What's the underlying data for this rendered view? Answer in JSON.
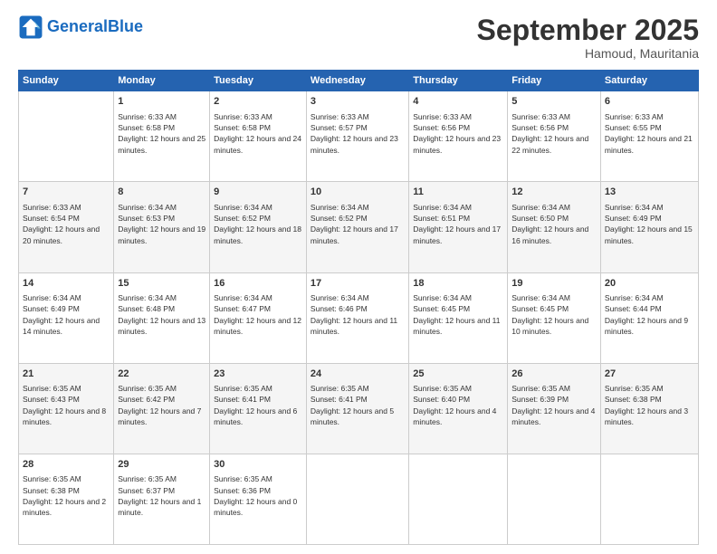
{
  "logo": {
    "text_general": "General",
    "text_blue": "Blue"
  },
  "header": {
    "title": "September 2025",
    "subtitle": "Hamoud, Mauritania"
  },
  "days_of_week": [
    "Sunday",
    "Monday",
    "Tuesday",
    "Wednesday",
    "Thursday",
    "Friday",
    "Saturday"
  ],
  "weeks": [
    [
      {
        "day": "",
        "sunrise": "",
        "sunset": "",
        "daylight": ""
      },
      {
        "day": "1",
        "sunrise": "Sunrise: 6:33 AM",
        "sunset": "Sunset: 6:58 PM",
        "daylight": "Daylight: 12 hours and 25 minutes."
      },
      {
        "day": "2",
        "sunrise": "Sunrise: 6:33 AM",
        "sunset": "Sunset: 6:58 PM",
        "daylight": "Daylight: 12 hours and 24 minutes."
      },
      {
        "day": "3",
        "sunrise": "Sunrise: 6:33 AM",
        "sunset": "Sunset: 6:57 PM",
        "daylight": "Daylight: 12 hours and 23 minutes."
      },
      {
        "day": "4",
        "sunrise": "Sunrise: 6:33 AM",
        "sunset": "Sunset: 6:56 PM",
        "daylight": "Daylight: 12 hours and 23 minutes."
      },
      {
        "day": "5",
        "sunrise": "Sunrise: 6:33 AM",
        "sunset": "Sunset: 6:56 PM",
        "daylight": "Daylight: 12 hours and 22 minutes."
      },
      {
        "day": "6",
        "sunrise": "Sunrise: 6:33 AM",
        "sunset": "Sunset: 6:55 PM",
        "daylight": "Daylight: 12 hours and 21 minutes."
      }
    ],
    [
      {
        "day": "7",
        "sunrise": "Sunrise: 6:33 AM",
        "sunset": "Sunset: 6:54 PM",
        "daylight": "Daylight: 12 hours and 20 minutes."
      },
      {
        "day": "8",
        "sunrise": "Sunrise: 6:34 AM",
        "sunset": "Sunset: 6:53 PM",
        "daylight": "Daylight: 12 hours and 19 minutes."
      },
      {
        "day": "9",
        "sunrise": "Sunrise: 6:34 AM",
        "sunset": "Sunset: 6:52 PM",
        "daylight": "Daylight: 12 hours and 18 minutes."
      },
      {
        "day": "10",
        "sunrise": "Sunrise: 6:34 AM",
        "sunset": "Sunset: 6:52 PM",
        "daylight": "Daylight: 12 hours and 17 minutes."
      },
      {
        "day": "11",
        "sunrise": "Sunrise: 6:34 AM",
        "sunset": "Sunset: 6:51 PM",
        "daylight": "Daylight: 12 hours and 17 minutes."
      },
      {
        "day": "12",
        "sunrise": "Sunrise: 6:34 AM",
        "sunset": "Sunset: 6:50 PM",
        "daylight": "Daylight: 12 hours and 16 minutes."
      },
      {
        "day": "13",
        "sunrise": "Sunrise: 6:34 AM",
        "sunset": "Sunset: 6:49 PM",
        "daylight": "Daylight: 12 hours and 15 minutes."
      }
    ],
    [
      {
        "day": "14",
        "sunrise": "Sunrise: 6:34 AM",
        "sunset": "Sunset: 6:49 PM",
        "daylight": "Daylight: 12 hours and 14 minutes."
      },
      {
        "day": "15",
        "sunrise": "Sunrise: 6:34 AM",
        "sunset": "Sunset: 6:48 PM",
        "daylight": "Daylight: 12 hours and 13 minutes."
      },
      {
        "day": "16",
        "sunrise": "Sunrise: 6:34 AM",
        "sunset": "Sunset: 6:47 PM",
        "daylight": "Daylight: 12 hours and 12 minutes."
      },
      {
        "day": "17",
        "sunrise": "Sunrise: 6:34 AM",
        "sunset": "Sunset: 6:46 PM",
        "daylight": "Daylight: 12 hours and 11 minutes."
      },
      {
        "day": "18",
        "sunrise": "Sunrise: 6:34 AM",
        "sunset": "Sunset: 6:45 PM",
        "daylight": "Daylight: 12 hours and 11 minutes."
      },
      {
        "day": "19",
        "sunrise": "Sunrise: 6:34 AM",
        "sunset": "Sunset: 6:45 PM",
        "daylight": "Daylight: 12 hours and 10 minutes."
      },
      {
        "day": "20",
        "sunrise": "Sunrise: 6:34 AM",
        "sunset": "Sunset: 6:44 PM",
        "daylight": "Daylight: 12 hours and 9 minutes."
      }
    ],
    [
      {
        "day": "21",
        "sunrise": "Sunrise: 6:35 AM",
        "sunset": "Sunset: 6:43 PM",
        "daylight": "Daylight: 12 hours and 8 minutes."
      },
      {
        "day": "22",
        "sunrise": "Sunrise: 6:35 AM",
        "sunset": "Sunset: 6:42 PM",
        "daylight": "Daylight: 12 hours and 7 minutes."
      },
      {
        "day": "23",
        "sunrise": "Sunrise: 6:35 AM",
        "sunset": "Sunset: 6:41 PM",
        "daylight": "Daylight: 12 hours and 6 minutes."
      },
      {
        "day": "24",
        "sunrise": "Sunrise: 6:35 AM",
        "sunset": "Sunset: 6:41 PM",
        "daylight": "Daylight: 12 hours and 5 minutes."
      },
      {
        "day": "25",
        "sunrise": "Sunrise: 6:35 AM",
        "sunset": "Sunset: 6:40 PM",
        "daylight": "Daylight: 12 hours and 4 minutes."
      },
      {
        "day": "26",
        "sunrise": "Sunrise: 6:35 AM",
        "sunset": "Sunset: 6:39 PM",
        "daylight": "Daylight: 12 hours and 4 minutes."
      },
      {
        "day": "27",
        "sunrise": "Sunrise: 6:35 AM",
        "sunset": "Sunset: 6:38 PM",
        "daylight": "Daylight: 12 hours and 3 minutes."
      }
    ],
    [
      {
        "day": "28",
        "sunrise": "Sunrise: 6:35 AM",
        "sunset": "Sunset: 6:38 PM",
        "daylight": "Daylight: 12 hours and 2 minutes."
      },
      {
        "day": "29",
        "sunrise": "Sunrise: 6:35 AM",
        "sunset": "Sunset: 6:37 PM",
        "daylight": "Daylight: 12 hours and 1 minute."
      },
      {
        "day": "30",
        "sunrise": "Sunrise: 6:35 AM",
        "sunset": "Sunset: 6:36 PM",
        "daylight": "Daylight: 12 hours and 0 minutes."
      },
      {
        "day": "",
        "sunrise": "",
        "sunset": "",
        "daylight": ""
      },
      {
        "day": "",
        "sunrise": "",
        "sunset": "",
        "daylight": ""
      },
      {
        "day": "",
        "sunrise": "",
        "sunset": "",
        "daylight": ""
      },
      {
        "day": "",
        "sunrise": "",
        "sunset": "",
        "daylight": ""
      }
    ]
  ]
}
